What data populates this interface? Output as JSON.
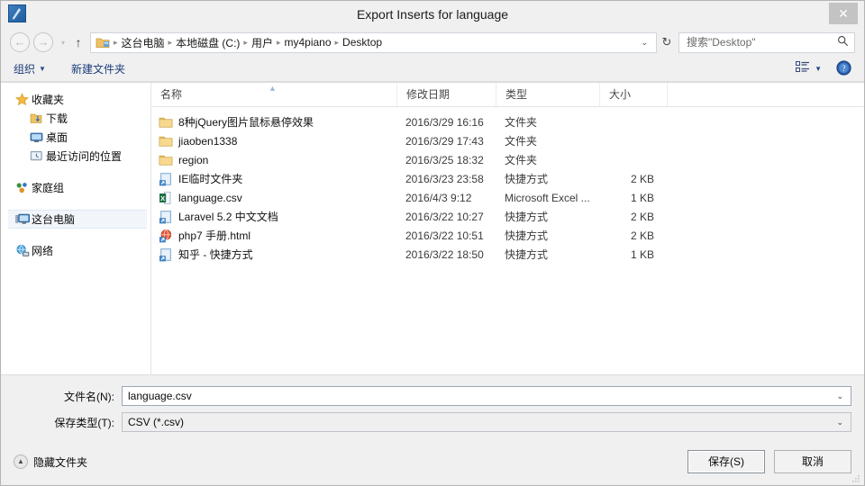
{
  "window": {
    "title": "Export Inserts for language",
    "icon": "app-icon",
    "close_label": "✕"
  },
  "nav": {
    "back_label": "←",
    "forward_label": "→",
    "history_label": "▾",
    "up_label": "↑",
    "breadcrumb": [
      "这台电脑",
      "本地磁盘 (C:)",
      "用户",
      "my4piano",
      "Desktop"
    ],
    "breadcrumb_separator": "▸",
    "address_dropdown_label": "⌄",
    "refresh_label": "↻"
  },
  "search": {
    "placeholder": "搜索\"Desktop\"",
    "value": "",
    "icon_label": "⌕"
  },
  "toolbar": {
    "organize_label": "组织",
    "organize_caret": "▼",
    "new_folder_label": "新建文件夹",
    "view_caret": "▼",
    "help_label": "?"
  },
  "sidebar": {
    "items": [
      {
        "label": "收藏夹",
        "icon": "star-icon",
        "level": 0,
        "selected": false
      },
      {
        "label": "下载",
        "icon": "downloads-icon",
        "level": 1,
        "selected": false
      },
      {
        "label": "桌面",
        "icon": "desktop-icon",
        "level": 1,
        "selected": false
      },
      {
        "label": "最近访问的位置",
        "icon": "recent-icon",
        "level": 1,
        "selected": false
      },
      {
        "label": "家庭组",
        "icon": "homegroup-icon",
        "level": 0,
        "selected": false
      },
      {
        "label": "这台电脑",
        "icon": "computer-icon",
        "level": 0,
        "selected": true
      },
      {
        "label": "网络",
        "icon": "network-icon",
        "level": 0,
        "selected": false
      }
    ]
  },
  "filelist": {
    "columns": [
      "名称",
      "修改日期",
      "类型",
      "大小"
    ],
    "sort_column": "名称",
    "sort_direction": "asc",
    "sort_marker": "▲",
    "rows": [
      {
        "name": "8种jQuery图片鼠标悬停效果",
        "date": "2016/3/29 16:16",
        "type": "文件夹",
        "size": "",
        "icon": "folder-icon"
      },
      {
        "name": "jiaoben1338",
        "date": "2016/3/29 17:43",
        "type": "文件夹",
        "size": "",
        "icon": "folder-icon"
      },
      {
        "name": "region",
        "date": "2016/3/25 18:32",
        "type": "文件夹",
        "size": "",
        "icon": "folder-icon"
      },
      {
        "name": "IE临时文件夹",
        "date": "2016/3/23 23:58",
        "type": "快捷方式",
        "size": "2 KB",
        "icon": "shortcut-icon"
      },
      {
        "name": "language.csv",
        "date": "2016/4/3 9:12",
        "type": "Microsoft Excel ...",
        "size": "1 KB",
        "icon": "excel-icon"
      },
      {
        "name": "Laravel 5.2 中文文档",
        "date": "2016/3/22 10:27",
        "type": "快捷方式",
        "size": "2 KB",
        "icon": "shortcut-icon"
      },
      {
        "name": "php7 手册.html",
        "date": "2016/3/22 10:51",
        "type": "快捷方式",
        "size": "2 KB",
        "icon": "html-shortcut-icon"
      },
      {
        "name": "知乎 - 快捷方式",
        "date": "2016/3/22 18:50",
        "type": "快捷方式",
        "size": "1 KB",
        "icon": "shortcut-icon"
      }
    ]
  },
  "form": {
    "filename_label": "文件名(N):",
    "filename_value": "language.csv",
    "filetype_label": "保存类型(T):",
    "filetype_value": "CSV (*.csv)",
    "caret": "⌄"
  },
  "footer": {
    "hide_folders_label": "隐藏文件夹",
    "hide_folders_caret": "▲",
    "save_label": "保存(S)",
    "cancel_label": "取消"
  },
  "colors": {
    "accent": "#1b3c7a",
    "folder": "#f5d07a",
    "shortcut": "#4a90d9",
    "excel": "#1e7145",
    "window_bg": "#f0f0f0"
  }
}
